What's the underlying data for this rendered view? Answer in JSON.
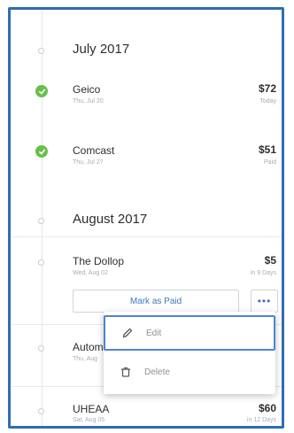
{
  "sections": [
    {
      "month": "July 2017",
      "bills": [
        {
          "name": "Geico",
          "date": "Thu, Jul 20",
          "amount": "$72",
          "status": "Today",
          "paid": true
        },
        {
          "name": "Comcast",
          "date": "Thu, Jul 27",
          "amount": "$51",
          "status": "Paid",
          "paid": true
        }
      ]
    },
    {
      "month": "August 2017",
      "bills": [
        {
          "name": "The Dollop",
          "date": "Wed, Aug 02",
          "amount": "$5",
          "status": "in 9 Days",
          "paid": false
        },
        {
          "name": "Automa",
          "date": "Thu, Aug",
          "amount": "",
          "status": "",
          "paid": false
        },
        {
          "name": "UHEAA",
          "date": "Sat, Aug 05",
          "amount": "$60",
          "status": "in 12 Days",
          "paid": false
        }
      ]
    }
  ],
  "actions": {
    "mark_paid_label": "Mark as Paid",
    "more_label": "•••"
  },
  "menu": {
    "edit_label": "Edit",
    "delete_label": "Delete"
  },
  "colors": {
    "accent": "#3a78c2",
    "paid_green": "#6abf4b",
    "focus_border": "#2f6db5"
  },
  "icons": {
    "paid": "check-icon",
    "edit": "pencil-icon",
    "delete": "trash-icon",
    "more": "more-dots-icon"
  }
}
